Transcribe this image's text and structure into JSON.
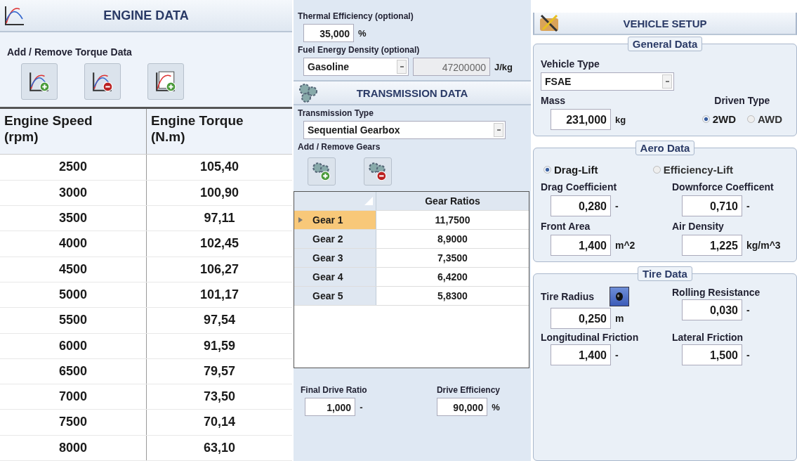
{
  "engine": {
    "title": "ENGINE DATA",
    "add_remove_label": "Add / Remove Torque Data",
    "columns": [
      "Engine Speed\n(rpm)",
      "Engine Torque\n(N.m)"
    ],
    "rows": [
      [
        "2500",
        "105,40"
      ],
      [
        "3000",
        "100,90"
      ],
      [
        "3500",
        "97,11"
      ],
      [
        "4000",
        "102,45"
      ],
      [
        "4500",
        "106,27"
      ],
      [
        "5000",
        "101,17"
      ],
      [
        "5500",
        "97,54"
      ],
      [
        "6000",
        "91,59"
      ],
      [
        "6500",
        "79,57"
      ],
      [
        "7000",
        "73,50"
      ],
      [
        "7500",
        "70,14"
      ],
      [
        "8000",
        "63,10"
      ]
    ]
  },
  "fuel": {
    "thermal_label": "Thermal Efficiency (optional)",
    "thermal_value": "35,000",
    "thermal_unit": "%",
    "density_label": "Fuel Energy Density (optional)",
    "fuel_type": "Gasoline",
    "density_value": "47200000",
    "density_unit": "J/kg"
  },
  "transmission": {
    "title": "TRANSMISSION DATA",
    "type_label": "Transmission Type",
    "type_value": "Sequential Gearbox",
    "gears_label": "Add / Remove Gears",
    "grid_header": "Gear Ratios",
    "gears": [
      {
        "name": "Gear 1",
        "ratio": "11,7500",
        "selected": true
      },
      {
        "name": "Gear 2",
        "ratio": "8,9000",
        "selected": false
      },
      {
        "name": "Gear 3",
        "ratio": "7,3500",
        "selected": false
      },
      {
        "name": "Gear 4",
        "ratio": "6,4200",
        "selected": false
      },
      {
        "name": "Gear 5",
        "ratio": "5,8300",
        "selected": false
      }
    ],
    "final_drive": {
      "label": "Final Drive Ratio",
      "value": "1,000",
      "unit": "-"
    },
    "drive_efficiency": {
      "label": "Drive Efficiency",
      "value": "90,000",
      "unit": "%"
    }
  },
  "vehicle": {
    "title": "VEHICLE SETUP",
    "general": {
      "legend": "General Data",
      "type_label": "Vehicle Type",
      "type_value": "FSAE",
      "mass_label": "Mass",
      "mass_value": "231,000",
      "mass_unit": "kg",
      "driven_label": "Driven Type",
      "driven_options": [
        {
          "label": "2WD",
          "selected": true
        },
        {
          "label": "AWD",
          "selected": false
        }
      ]
    },
    "aero": {
      "legend": "Aero Data",
      "modes": [
        {
          "label": "Drag-Lift",
          "selected": true
        },
        {
          "label": "Efficiency-Lift",
          "selected": false
        }
      ],
      "fields": [
        {
          "label": "Drag Coefficient",
          "value": "0,280",
          "unit": "-"
        },
        {
          "label": "Downforce Coefficent",
          "value": "0,710",
          "unit": "-"
        },
        {
          "label": "Front Area",
          "value": "1,400",
          "unit": "m^2"
        },
        {
          "label": "Air Density",
          "value": "1,225",
          "unit": "kg/m^3"
        }
      ]
    },
    "tire": {
      "legend": "Tire Data",
      "fields": [
        {
          "label": "Tire Radius",
          "value": "0,250",
          "unit": "m"
        },
        {
          "label": "Rolling Resistance",
          "value": "0,030",
          "unit": "-"
        },
        {
          "label": "Longitudinal Friction",
          "value": "1,400",
          "unit": "-"
        },
        {
          "label": "Lateral Friction",
          "value": "1,500",
          "unit": "-"
        }
      ]
    }
  }
}
